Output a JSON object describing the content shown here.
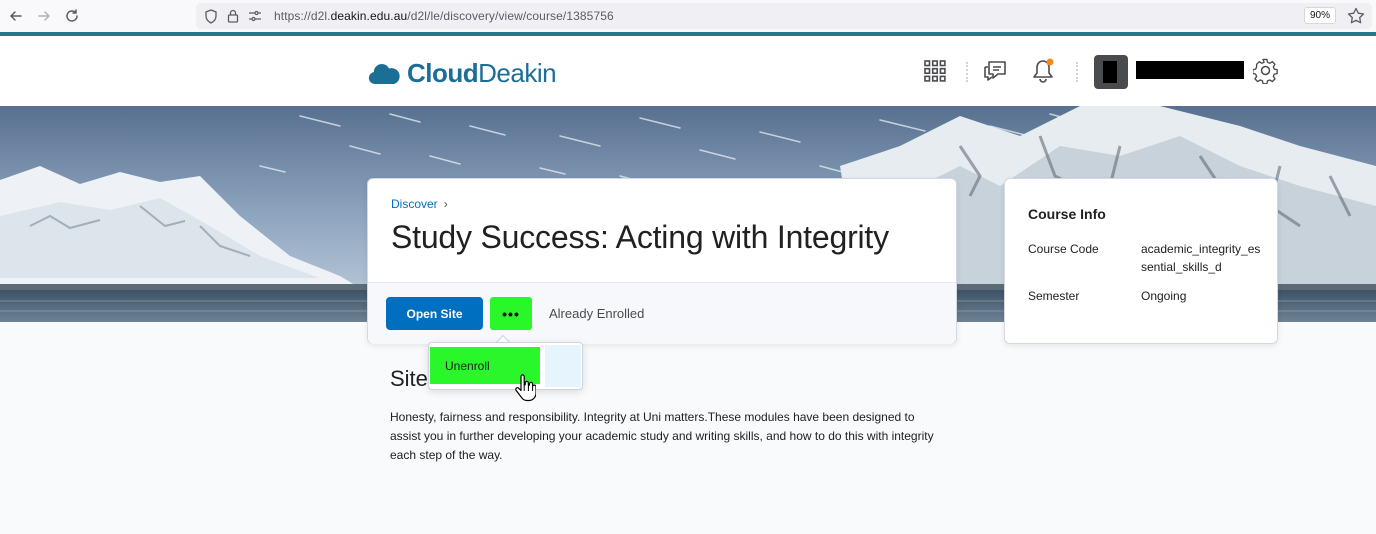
{
  "browser": {
    "url_prefix": "https://d2l.",
    "url_domain": "deakin.edu.au",
    "url_path": "/d2l/le/discovery/view/course/1385756",
    "zoom": "90%"
  },
  "header": {
    "logo_bold": "Cloud",
    "logo_light": "Deakin",
    "notification_dot_color": "#f28b1e"
  },
  "course": {
    "breadcrumb": "Discover",
    "title": "Study Success: Acting with Integrity",
    "open_site_label": "Open Site",
    "more_label": "•••",
    "status": "Already Enrolled"
  },
  "dropdown": {
    "items": [
      {
        "label": "Unenroll"
      }
    ]
  },
  "info": {
    "title": "Course Info",
    "rows": [
      {
        "label": "Course Code",
        "value": "academic_integrity_essential_skills_d"
      },
      {
        "label": "Semester",
        "value": "Ongoing"
      }
    ]
  },
  "site": {
    "heading": "Site",
    "description": "Honesty, fairness and responsibility. Integrity at Uni matters.These modules have been designed to assist you in further developing your academic study and writing skills, and how to do this with integrity each step of the way."
  },
  "colors": {
    "accent": "#23788c",
    "primary": "#006fbf",
    "highlight": "#2af72a"
  }
}
